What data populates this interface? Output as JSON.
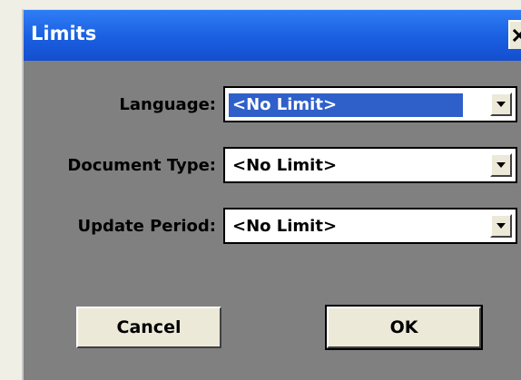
{
  "window": {
    "title": "Limits",
    "close_glyph": "×"
  },
  "fields": [
    {
      "label": "Language:",
      "value": "<No Limit>",
      "selected": true
    },
    {
      "label": "Document Type:",
      "value": "<No Limit>",
      "selected": false
    },
    {
      "label": "Update Period:",
      "value": "<No Limit>",
      "selected": false
    }
  ],
  "buttons": {
    "cancel_label": "Cancel",
    "ok_label": "OK"
  },
  "colors": {
    "titlebar": "#1a5fe0",
    "dialog_bg": "#808080",
    "selection": "#2f5fc9",
    "button_face": "#ece9d8"
  },
  "icons": {
    "close": "close-icon",
    "dropdown": "chevron-down-icon"
  }
}
